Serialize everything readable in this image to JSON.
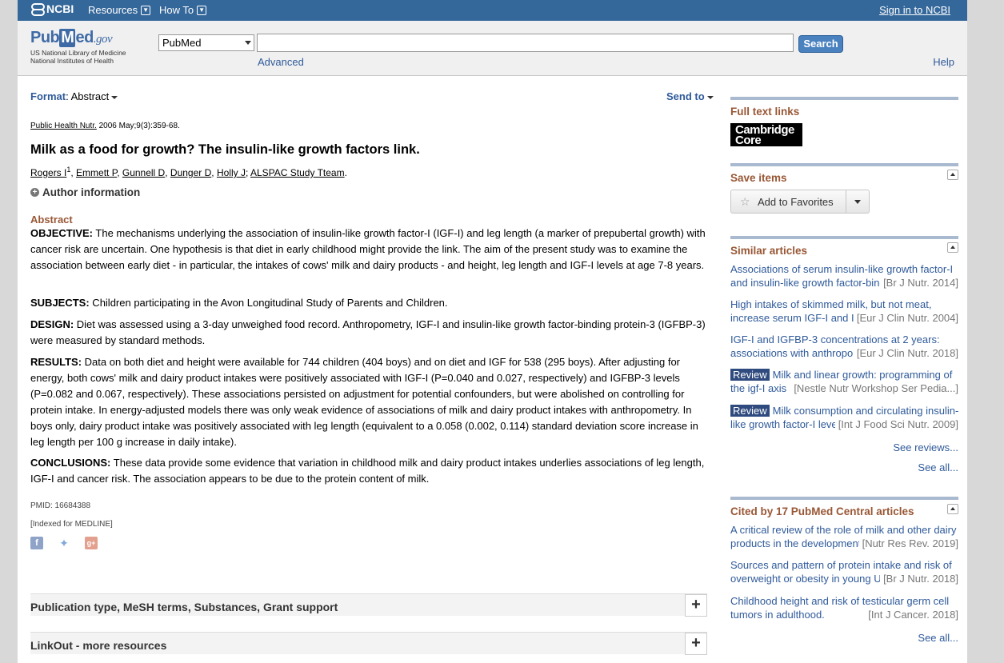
{
  "ncbi": {
    "logo": "NCBI",
    "resources": "Resources",
    "howto": "How To",
    "signin": "Sign in to NCBI"
  },
  "search": {
    "logo_pub": "Pub",
    "logo_m": "M",
    "logo_ed": "ed",
    "logo_gov": ".gov",
    "logo_sub1": "US National Library of Medicine",
    "logo_sub2": "National Institutes of Health",
    "database": "PubMed",
    "query": "",
    "button": "Search",
    "advanced": "Advanced",
    "help": "Help"
  },
  "article": {
    "format_label": "Format",
    "format_value": "Abstract",
    "send_to": "Send to",
    "journal": "Public Health Nutr.",
    "citation": " 2006 May;9(3):359-68.",
    "title": "Milk as a food for growth? The insulin-like growth factors link.",
    "authors": [
      "Rogers I",
      "Emmett P",
      "Gunnell D",
      "Dunger D",
      "Holly J",
      "ALSPAC Study Tteam"
    ],
    "author_sup": "1",
    "author_info": "Author information",
    "abstract_heading": "Abstract",
    "sections": [
      {
        "label": "OBJECTIVE:",
        "text": " The mechanisms underlying the association of insulin-like growth factor-I (IGF-I) and leg length (a marker of prepubertal growth) with cancer risk are uncertain. One hypothesis is that diet in early childhood might provide the link. The aim of the present study was to examine the association between early diet - in particular, the intakes of cows' milk and dairy products - and height, leg length and IGF-I levels at age 7-8 years."
      },
      {
        "label": "SUBJECTS:",
        "text": " Children participating in the Avon Longitudinal Study of Parents and Children."
      },
      {
        "label": "DESIGN:",
        "text": " Diet was assessed using a 3-day unweighed food record. Anthropometry, IGF-I and insulin-like growth factor-binding protein-3 (IGFBP-3) were measured by standard methods."
      },
      {
        "label": "RESULTS:",
        "text": " Data on both diet and height were available for 744 children (404 boys) and on diet and IGF for 538 (295 boys). After adjusting for energy, both cows' milk and dairy product intakes were positively associated with IGF-I (P=0.040 and 0.027, respectively) and IGFBP-3 levels (P=0.082 and 0.067, respectively). These associations persisted on adjustment for potential confounders, but were abolished on controlling for protein intake. In energy-adjusted models there was only weak evidence of associations of milk and dairy product intakes with anthropometry. In boys only, dairy product intake was positively associated with leg length (equivalent to a 0.058 (0.002, 0.114) standard deviation score increase in leg length per 100 g increase in daily intake)."
      },
      {
        "label": "CONCLUSIONS:",
        "text": " These data provide some evidence that variation in childhood milk and dairy product intakes underlies associations of leg length, IGF-I and cancer risk. The association appears to be due to the protein content of milk."
      }
    ],
    "pmid": "PMID: 16684388",
    "indexed": "[Indexed for MEDLINE]",
    "accordion1": "Publication type, MeSH terms, Substances, Grant support",
    "accordion2": "LinkOut - more resources"
  },
  "sidebar": {
    "full_text": "Full text links",
    "cambridge1": "Cambridge",
    "cambridge2": "Core",
    "save_items": "Save items",
    "add_fav": "Add to Favorites",
    "similar_heading": "Similar articles",
    "similar": [
      {
        "l1": "Associations of serum insulin-like growth factor-I",
        "l2": "and insulin-like growth factor-bind",
        "src": "[Br J Nutr. 2014]",
        "review": ""
      },
      {
        "l1": "High intakes of skimmed milk, but not meat,",
        "l2": "increase serum IGF-I and I",
        "src": "[Eur J Clin Nutr. 2004]",
        "review": ""
      },
      {
        "l1": "IGF-I and IGFBP-3 concentrations at 2 years:",
        "l2": "associations with anthropo",
        "src": "[Eur J Clin Nutr. 2018]",
        "review": ""
      },
      {
        "l1": "Milk and linear growth: programming of",
        "l2": "the igf-I axis",
        "src": "[Nestle Nutr Workshop Ser Pedia...]",
        "review": "Review"
      },
      {
        "l1": "Milk consumption and circulating insulin-",
        "l2": "like growth factor-I leve",
        "src": "[Int J Food Sci Nutr. 2009]",
        "review": "Review"
      }
    ],
    "see_reviews": "See reviews...",
    "see_all": "See all...",
    "cited_heading": "Cited by 17 PubMed Central articles",
    "cited": [
      {
        "l1": "A critical review of the role of milk and other dairy",
        "l2": "products in the development",
        "src": "[Nutr Res Rev. 2019]"
      },
      {
        "l1": "Sources and pattern of protein intake and risk of",
        "l2": "overweight or obesity in young U",
        "src": "[Br J Nutr. 2018]"
      },
      {
        "l1": "Childhood height and risk of testicular germ cell",
        "l2": "tumors in adulthood.",
        "src": "[Int J Cancer. 2018]"
      }
    ],
    "see_all2": "See all..."
  }
}
